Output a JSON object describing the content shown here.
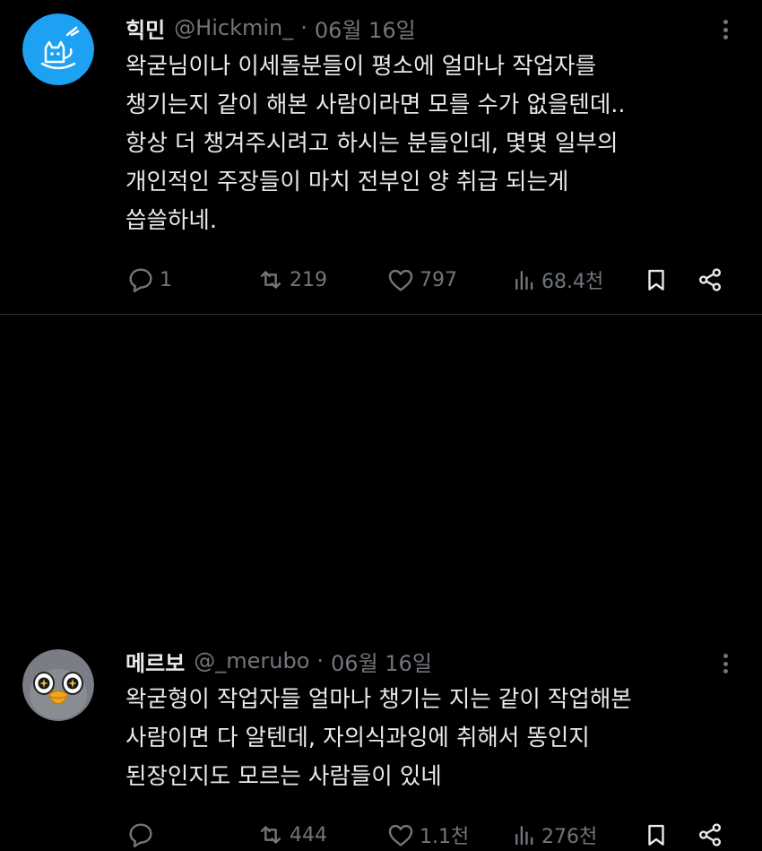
{
  "tweets": [
    {
      "name": "힉민",
      "handle": "@Hickmin_",
      "separator": "·",
      "date": "06월 16일",
      "lines": [
        "왁굳님이나 이세돌분들이 평소에 얼마나 작업자를",
        "챙기는지 같이 해본 사람이라면 모를 수가 없을텐데..",
        "항상 더 챙겨주시려고 하시는 분들인데, 몇몇 일부의",
        "개인적인 주장들이 마치 전부인 양 취급 되는게",
        "씁쓸하네."
      ],
      "replies": "1",
      "retweets": "219",
      "likes": "797",
      "views": "68.4천",
      "avatar_color": "#1da1f2"
    },
    {
      "name": "메르보",
      "handle": "@_merubo",
      "separator": "·",
      "date": "06월 16일",
      "lines": [
        "왁굳형이 작업자들 얼마나 챙기는 지는 같이 작업해본",
        "사람이면 다 알텐데, 자의식과잉에 취해서 똥인지",
        "된장인지도 모르는 사람들이 있네"
      ],
      "replies": "",
      "retweets": "444",
      "likes": "1.1천",
      "views": "276천",
      "avatar_color": "#7a7d86"
    }
  ],
  "icons": {
    "more": "more-dots-icon",
    "reply": "reply-icon",
    "retweet": "retweet-icon",
    "like": "heart-icon",
    "views": "views-bar-chart-icon",
    "bookmark": "bookmark-icon",
    "share": "share-icon"
  },
  "colors": {
    "background": "#000000",
    "text": "#e7e9ea",
    "muted": "#71767b",
    "divider": "#2f3336"
  }
}
